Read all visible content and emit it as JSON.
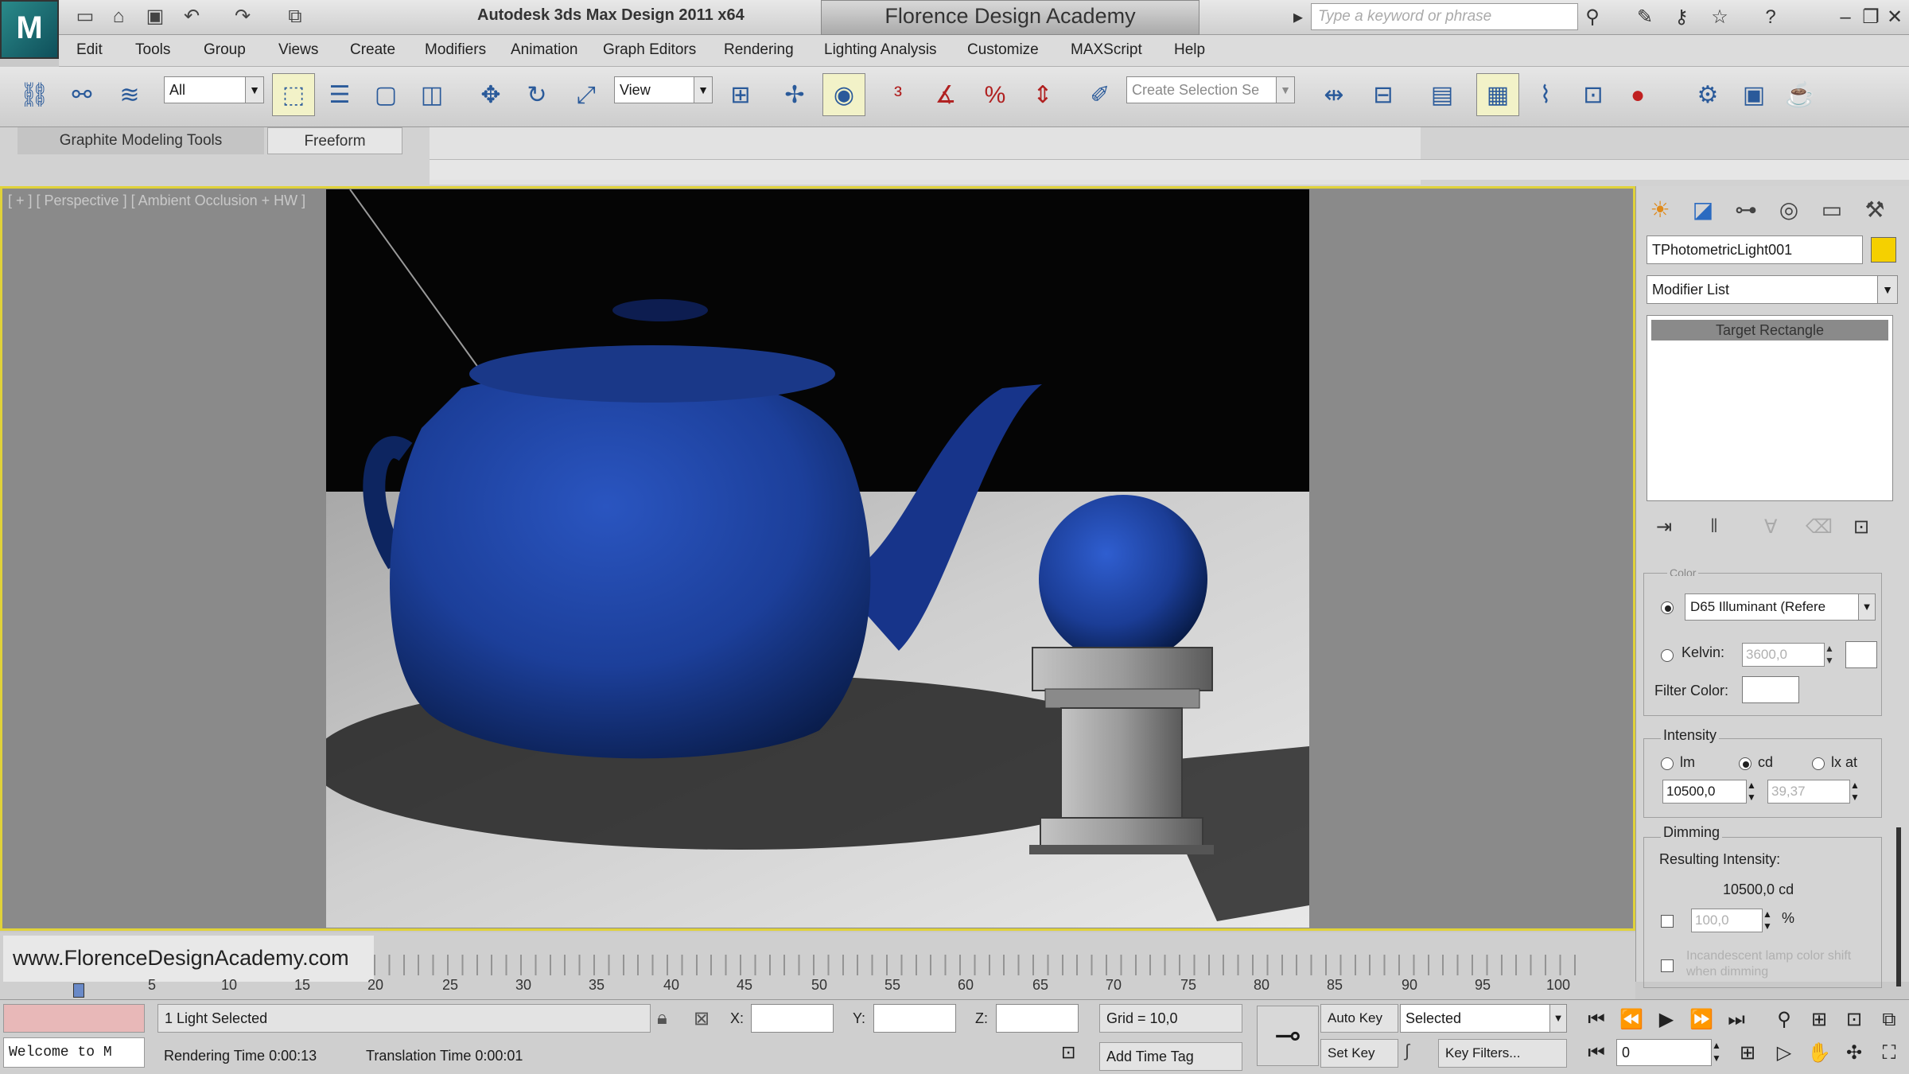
{
  "titlebar": {
    "app_title": "Autodesk 3ds Max Design 2011 x64",
    "academy": "Florence Design Academy",
    "search_placeholder": "Type a keyword or phrase",
    "logo": "M",
    "window_controls": [
      "–",
      "❐",
      "✕"
    ]
  },
  "menu": [
    "Edit",
    "Tools",
    "Group",
    "Views",
    "Create",
    "Modifiers",
    "Animation",
    "Graph Editors",
    "Rendering",
    "Lighting Analysis",
    "Customize",
    "MAXScript",
    "Help"
  ],
  "toolbar": {
    "selection_filter": "All",
    "ref_coord": "View",
    "named_selection_placeholder": "Create Selection Se"
  },
  "ribbon": {
    "tabs": [
      "Graphite Modeling Tools",
      "Freeform"
    ]
  },
  "viewport": {
    "label": "[ + ] [ Perspective ] [ Ambient Occlusion + HW ]"
  },
  "command_panel": {
    "object_name": "TPhotometricLight001",
    "modifier_list": "Modifier List",
    "stack_item": "Target Rectangle",
    "color_group": "Color",
    "color_preset": "D65 Illuminant (Refere",
    "kelvin_label": "Kelvin:",
    "kelvin_value": "3600,0",
    "filter_color_label": "Filter Color:",
    "intensity_group": "Intensity",
    "units": [
      "lm",
      "cd",
      "lx at"
    ],
    "intensity_value": "10500,0",
    "lx_distance": "39,37",
    "dimming_group": "Dimming",
    "resulting_label": "Resulting Intensity:",
    "resulting_value": "10500,0 cd",
    "dimming_percent": "100,0",
    "percent_sign": "%",
    "incandescent_label": "Incandescent lamp color shift when dimming"
  },
  "timeline": {
    "url": "www.FlorenceDesignAcademy.com",
    "ticks": [
      "5",
      "10",
      "15",
      "20",
      "25",
      "30",
      "35",
      "40",
      "45",
      "50",
      "55",
      "60",
      "65",
      "70",
      "75",
      "80",
      "85",
      "90",
      "95",
      "100"
    ]
  },
  "status": {
    "maxscript": "Welcome to M",
    "selection": "1 Light Selected",
    "rendering_time": "Rendering Time  0:00:13",
    "translation_time": "Translation Time  0:00:01",
    "x_label": "X:",
    "y_label": "Y:",
    "z_label": "Z:",
    "grid": "Grid = 10,0",
    "add_time_tag": "Add Time Tag",
    "auto_key": "Auto Key",
    "set_key": "Set Key",
    "selected": "Selected",
    "key_filters": "Key Filters...",
    "frame": "0"
  },
  "colors": {
    "viewport_border": "#e0d23a",
    "teapot": "#1c3f9a",
    "light_swatch": "#f5d000"
  }
}
